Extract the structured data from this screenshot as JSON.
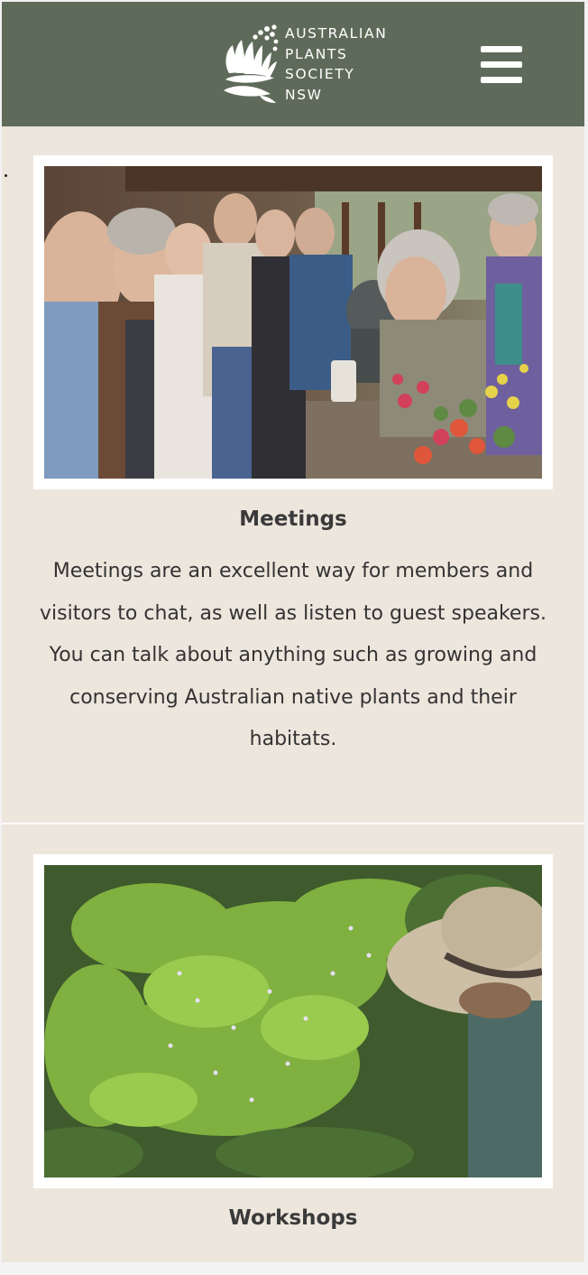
{
  "header": {
    "logo_lines": [
      "AUSTRALIAN",
      "PLANTS",
      "SOCIETY",
      "NSW"
    ],
    "menu_icon": "hamburger-menu-icon",
    "background_color": "#5f6b5a"
  },
  "cards": [
    {
      "title": "Meetings",
      "text": "Meetings are an excellent way for members and visitors to chat, as well as listen to guest speakers. You can talk about anything such as growing and conserving Australian native plants and their habitats.",
      "image_alt": "photo of members gathered on a verandah around native flowers"
    },
    {
      "title": "Workshops",
      "text": "",
      "image_alt": "photo of a person in a hat among green native shrubs"
    }
  ],
  "colors": {
    "page_background": "#ede6dd",
    "title_text": "#3a3a3a",
    "body_text": "#333333"
  }
}
